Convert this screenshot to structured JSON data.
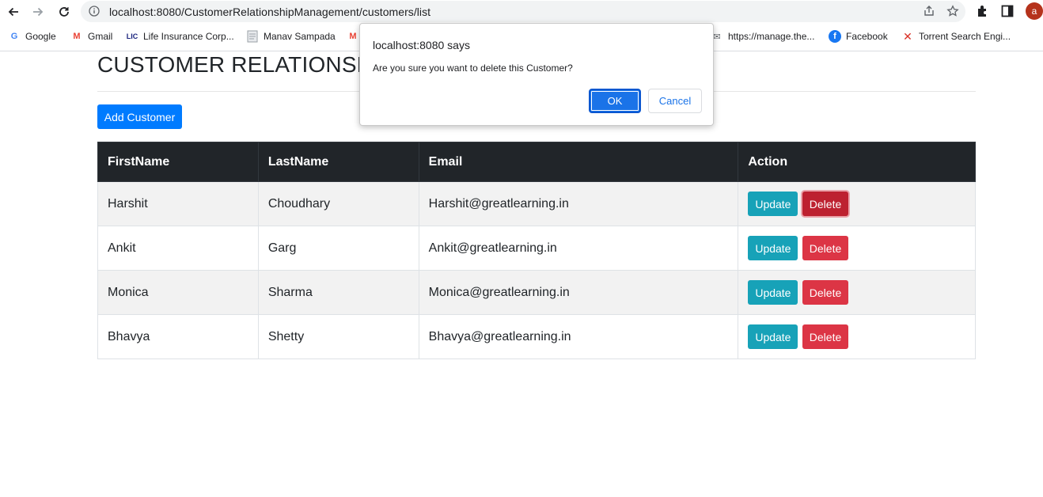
{
  "browser": {
    "url": "localhost:8080/CustomerRelationshipManagement/customers/list",
    "avatar_letter": "a"
  },
  "bookmarks": [
    {
      "label": "Google",
      "icon": "google-icon"
    },
    {
      "label": "Gmail",
      "icon": "gmail-icon"
    },
    {
      "label": "Life Insurance Corp...",
      "icon": "lic-icon"
    },
    {
      "label": "Manav Sampada",
      "icon": "doc-icon"
    },
    {
      "label": "https://manage.the...",
      "icon": "mail-icon"
    },
    {
      "label": "Facebook",
      "icon": "facebook-icon"
    },
    {
      "label": "Torrent Search Engi...",
      "icon": "x-icon"
    }
  ],
  "page": {
    "title": "CUSTOMER RELATIONSHI",
    "add_button": "Add Customer"
  },
  "table": {
    "headers": [
      "FirstName",
      "LastName",
      "Email",
      "Action"
    ],
    "rows": [
      {
        "first": "Harshit",
        "last": "Choudhary",
        "email": "Harshit@greatlearning.in"
      },
      {
        "first": "Ankit",
        "last": "Garg",
        "email": "Ankit@greatlearning.in"
      },
      {
        "first": "Monica",
        "last": "Sharma",
        "email": "Monica@greatlearning.in"
      },
      {
        "first": "Bhavya",
        "last": "Shetty",
        "email": "Bhavya@greatlearning.in"
      }
    ],
    "update_label": "Update",
    "delete_label": "Delete"
  },
  "dialog": {
    "title": "localhost:8080 says",
    "message": "Are you sure you want to delete this Customer?",
    "ok": "OK",
    "cancel": "Cancel"
  },
  "colors": {
    "primary": "#007bff",
    "info": "#17a2b8",
    "danger": "#dc3545",
    "dark": "#212529",
    "chrome_blue": "#1a73e8"
  }
}
